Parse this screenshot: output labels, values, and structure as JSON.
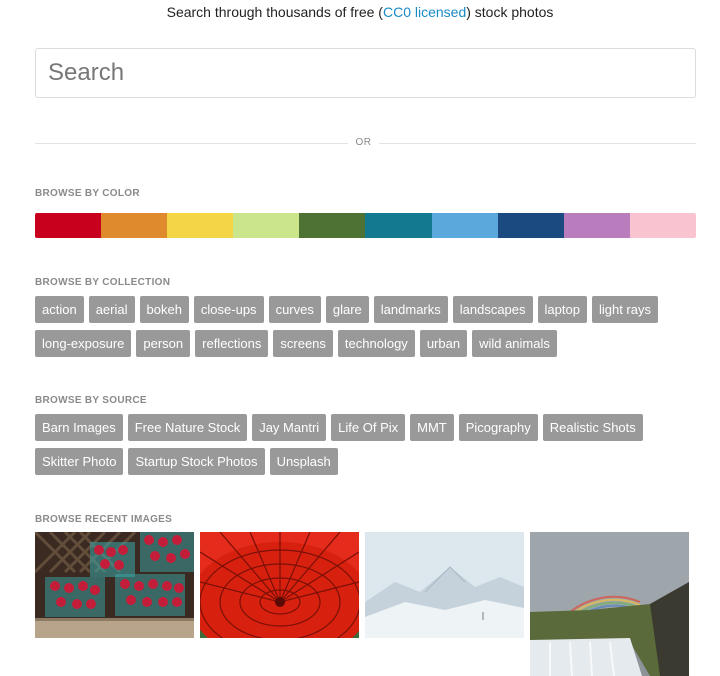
{
  "tagline": {
    "before": "Search through thousands of free (",
    "link": "CC0 licensed",
    "after": ") stock photos"
  },
  "search": {
    "placeholder": "Search"
  },
  "divider": {
    "label": "OR"
  },
  "browse_color": {
    "title": "BROWSE BY COLOR",
    "colors": [
      "#c8001e",
      "#e08a2e",
      "#f4d545",
      "#cbe58a",
      "#4d7234",
      "#137991",
      "#5ba9dc",
      "#1b4a80",
      "#b97cbc",
      "#fac3d0"
    ]
  },
  "browse_collection": {
    "title": "BROWSE BY COLLECTION",
    "tags": [
      "action",
      "aerial",
      "bokeh",
      "close-ups",
      "curves",
      "glare",
      "landmarks",
      "landscapes",
      "laptop",
      "light rays",
      "long-exposure",
      "person",
      "reflections",
      "screens",
      "technology",
      "urban",
      "wild animals"
    ]
  },
  "browse_source": {
    "title": "BROWSE BY SOURCE",
    "tags": [
      "Barn Images",
      "Free Nature Stock",
      "Jay Mantri",
      "Life Of Pix",
      "MMT",
      "Picography",
      "Realistic Shots",
      "Skitter Photo",
      "Startup Stock Photos",
      "Unsplash"
    ]
  },
  "recent": {
    "title": "BROWSE RECENT IMAGES",
    "images": [
      "raspberries-photo",
      "red-umbrella-photo",
      "snowy-mountain-photo",
      "rainbow-waterfall-photo"
    ]
  }
}
